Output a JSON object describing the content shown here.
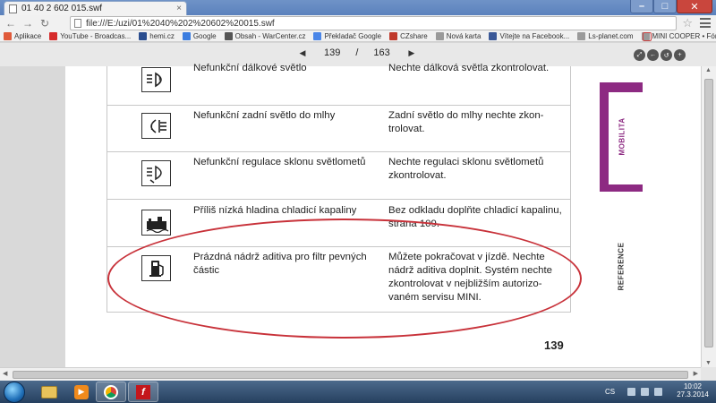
{
  "browser": {
    "tab_title": "01 40 2 602 015.swf",
    "tab_close": "×",
    "url": "file:///E:/uzi/01%2040%202%20602%20015.swf",
    "nav_back": "←",
    "nav_forward": "→",
    "nav_reload": "↻",
    "star": "☆",
    "minimize": "–",
    "maximize": "□",
    "close": "✕"
  },
  "bookmarks": [
    {
      "label": "Aplikace",
      "color": "#e05a3a"
    },
    {
      "label": "YouTube - Broadcas...",
      "color": "#d62b2b"
    },
    {
      "label": "hemi.cz",
      "color": "#2a4d8f"
    },
    {
      "label": "Google",
      "color": "#3b7de0"
    },
    {
      "label": "Obsah - WarCenter.cz",
      "color": "#555555"
    },
    {
      "label": "Překladač Google",
      "color": "#4a86e8"
    },
    {
      "label": "CZshare",
      "color": "#c0392b"
    },
    {
      "label": "Nová karta",
      "color": "#9a9a9a"
    },
    {
      "label": "Vítejte na Facebook...",
      "color": "#3b5998"
    },
    {
      "label": "Ls-planet.com",
      "color": "#9a9a9a"
    },
    {
      "label": "MINI COOPER • Fór...",
      "color": "#9a9a9a"
    }
  ],
  "viewer": {
    "prev": "◀",
    "next": "▶",
    "current_page": "139",
    "separator": "/",
    "total_pages": "163",
    "tools": [
      "⤢",
      "←",
      "↺",
      "+"
    ]
  },
  "table": {
    "rows": [
      {
        "icon": "high-beam-warning-icon",
        "fault": "Nefunkční dálkové světlo",
        "action": "Nechte dálková světla zkontrolovat."
      },
      {
        "icon": "rear-fog-warning-icon",
        "fault": "Nefunkční zadní světlo do mlhy",
        "action": "Zadní světlo do mlhy nechte zkon-trolovat."
      },
      {
        "icon": "headlight-leveling-icon",
        "fault": "Nefunkční regulace sklonu světlometů",
        "action": "Nechte regulaci sklonu světlometů zkontrolovat."
      },
      {
        "icon": "coolant-level-icon",
        "fault": "Příliš nízká hladina chladicí kapaliny",
        "action": "Bez odkladu doplňte chladicí kapalinu, strana 109."
      },
      {
        "icon": "additive-tank-icon",
        "fault": "Prázdná nádrž aditiva pro filtr pevných částic",
        "action": "Můžete pokračovat v jízdě. Nechte nádrž aditiva doplnit. Systém nechte zkontrolovat v nejbližším autorizo-vaném servisu MINI."
      }
    ]
  },
  "page_number": "139",
  "side_tabs": {
    "mobility": "MOBILITA",
    "reference": "REFERENCE"
  },
  "colors": {
    "accent_purple": "#8d2a82",
    "highlight_red": "#c8323a"
  },
  "taskbar": {
    "lang": "CS",
    "time": "10:02",
    "date": "27.3.2014",
    "apps": [
      "explorer-icon",
      "media-player-icon",
      "chrome-icon",
      "flash-player-icon"
    ]
  }
}
